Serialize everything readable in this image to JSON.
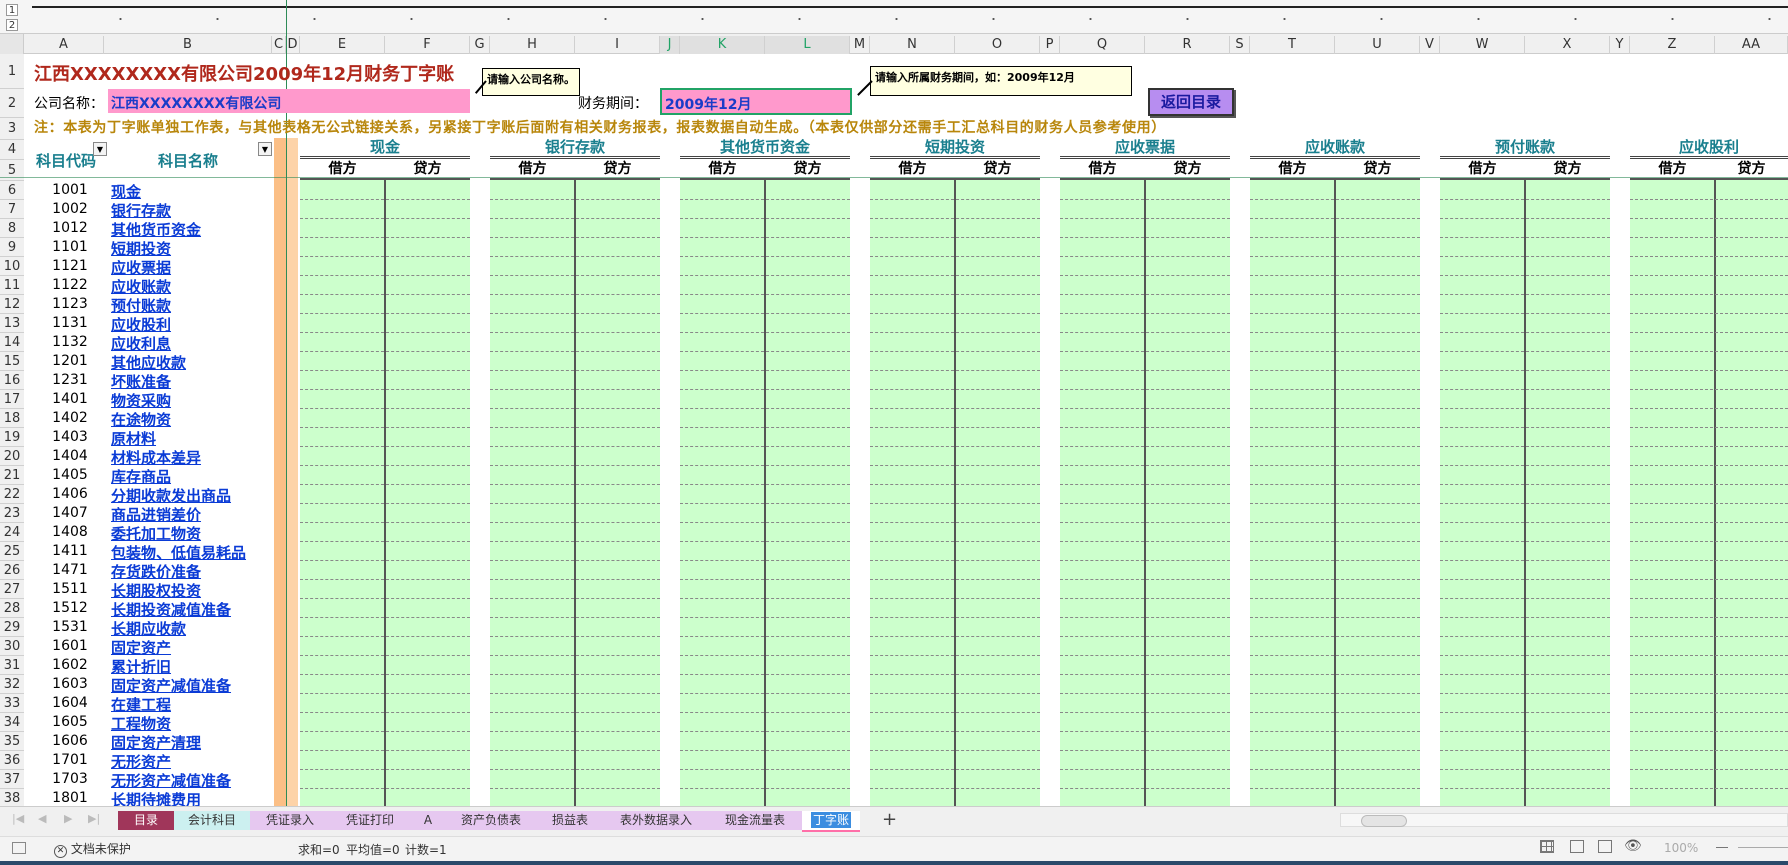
{
  "title": "江西XXXXXXXX有限公司2009年12月财务丁字账",
  "company_label": "公司名称：",
  "company_value": "江西XXXXXXXX有限公司",
  "period_label": "财务期间：",
  "period_value": "2009年12月",
  "note_company": "请输入公司名称。",
  "note_period": "请输入所属财务期间，如：2009年12月",
  "back_button": "返回目录",
  "notice": "注：本表为丁字账单独工作表，与其他表格无公式链接关系，另紧接丁字账后面附有相关财务报表，报表数据自动生成。（本表仅供部分还需手工汇总科目的财务人员参考使用）",
  "outline_levels": [
    "1",
    "2"
  ],
  "columns": [
    "A",
    "B",
    "C",
    "D",
    "E",
    "F",
    "G",
    "H",
    "I",
    "J",
    "K",
    "L",
    "M",
    "N",
    "O",
    "P",
    "Q",
    "R",
    "S",
    "T",
    "U",
    "V",
    "W",
    "X",
    "Y",
    "Z",
    "AA"
  ],
  "header_code": "科目代码",
  "header_name": "科目名称",
  "groups": [
    "现金",
    "银行存款",
    "其他货币资金",
    "短期投资",
    "应收票据",
    "应收账款",
    "预付账款",
    "应收股利"
  ],
  "debit": "借方",
  "credit": "贷方",
  "row_numbers": [
    "1",
    "2",
    "3",
    "4",
    "5",
    "6",
    "7",
    "8",
    "9",
    "10",
    "11",
    "12",
    "13",
    "14",
    "15",
    "16",
    "17",
    "18",
    "19",
    "20",
    "21",
    "22",
    "23",
    "24",
    "25",
    "26",
    "27",
    "28",
    "29",
    "30",
    "31",
    "32",
    "33",
    "34",
    "35",
    "36",
    "37",
    "38"
  ],
  "accounts": [
    {
      "code": "1001",
      "name": "现金"
    },
    {
      "code": "1002",
      "name": "银行存款"
    },
    {
      "code": "1012",
      "name": "其他货币资金"
    },
    {
      "code": "1101",
      "name": "短期投资"
    },
    {
      "code": "1121",
      "name": "应收票据"
    },
    {
      "code": "1122",
      "name": "应收账款"
    },
    {
      "code": "1123",
      "name": "预付账款"
    },
    {
      "code": "1131",
      "name": "应收股利"
    },
    {
      "code": "1132",
      "name": "应收利息"
    },
    {
      "code": "1201",
      "name": "其他应收款"
    },
    {
      "code": "1231",
      "name": "坏账准备"
    },
    {
      "code": "1401",
      "name": "物资采购"
    },
    {
      "code": "1402",
      "name": "在途物资"
    },
    {
      "code": "1403",
      "name": "原材料"
    },
    {
      "code": "1404",
      "name": "材料成本差异"
    },
    {
      "code": "1405",
      "name": "库存商品"
    },
    {
      "code": "1406",
      "name": "分期收款发出商品"
    },
    {
      "code": "1407",
      "name": "商品进销差价"
    },
    {
      "code": "1408",
      "name": "委托加工物资"
    },
    {
      "code": "1411",
      "name": "包装物、低值易耗品"
    },
    {
      "code": "1471",
      "name": "存货跌价准备"
    },
    {
      "code": "1511",
      "name": "长期股权投资"
    },
    {
      "code": "1512",
      "name": "长期投资减值准备"
    },
    {
      "code": "1531",
      "name": "长期应收款"
    },
    {
      "code": "1601",
      "name": "固定资产"
    },
    {
      "code": "1602",
      "name": "累计折旧"
    },
    {
      "code": "1603",
      "name": "固定资产减值准备"
    },
    {
      "code": "1604",
      "name": "在建工程"
    },
    {
      "code": "1605",
      "name": "工程物资"
    },
    {
      "code": "1606",
      "name": "固定资产清理"
    },
    {
      "code": "1701",
      "name": "无形资产"
    },
    {
      "code": "1703",
      "name": "无形资产减值准备"
    },
    {
      "code": "1801",
      "name": "长期待摊费用"
    }
  ],
  "sheet_tabs": [
    {
      "label": "目录",
      "bg": "#a0365a",
      "color": "#ffffff"
    },
    {
      "label": "会计科目",
      "bg": "#ccf0f0",
      "color": "#333333"
    },
    {
      "label": "凭证录入",
      "bg": "#e6c8f0",
      "color": "#333333"
    },
    {
      "label": "凭证打印",
      "bg": "#e6c8f0",
      "color": "#333333"
    },
    {
      "label": "A",
      "bg": "#e6c8f0",
      "color": "#333333"
    },
    {
      "label": "资产负债表",
      "bg": "#e6c8f0",
      "color": "#333333"
    },
    {
      "label": "损益表",
      "bg": "#e6c8f0",
      "color": "#333333"
    },
    {
      "label": "表外数据录入",
      "bg": "#e6c8f0",
      "color": "#333333"
    },
    {
      "label": "现金流量表",
      "bg": "#e6c8f0",
      "color": "#333333"
    },
    {
      "label": "丁字账",
      "bg": "#ffffff",
      "color": "#ffffff"
    }
  ],
  "add_sheet": "+",
  "status": {
    "protection": "文档未保护",
    "sum": "求和=0",
    "avg": "平均值=0",
    "count": "计数=1",
    "zoom": "100%"
  },
  "colors": {
    "title": "#b0281c",
    "pink": "#ff99cc",
    "green": "#ccffcc",
    "orange": "#fbbf86",
    "teal": "#1a7f8e",
    "link": "#0a3bd6",
    "notice": "#b8860b"
  }
}
